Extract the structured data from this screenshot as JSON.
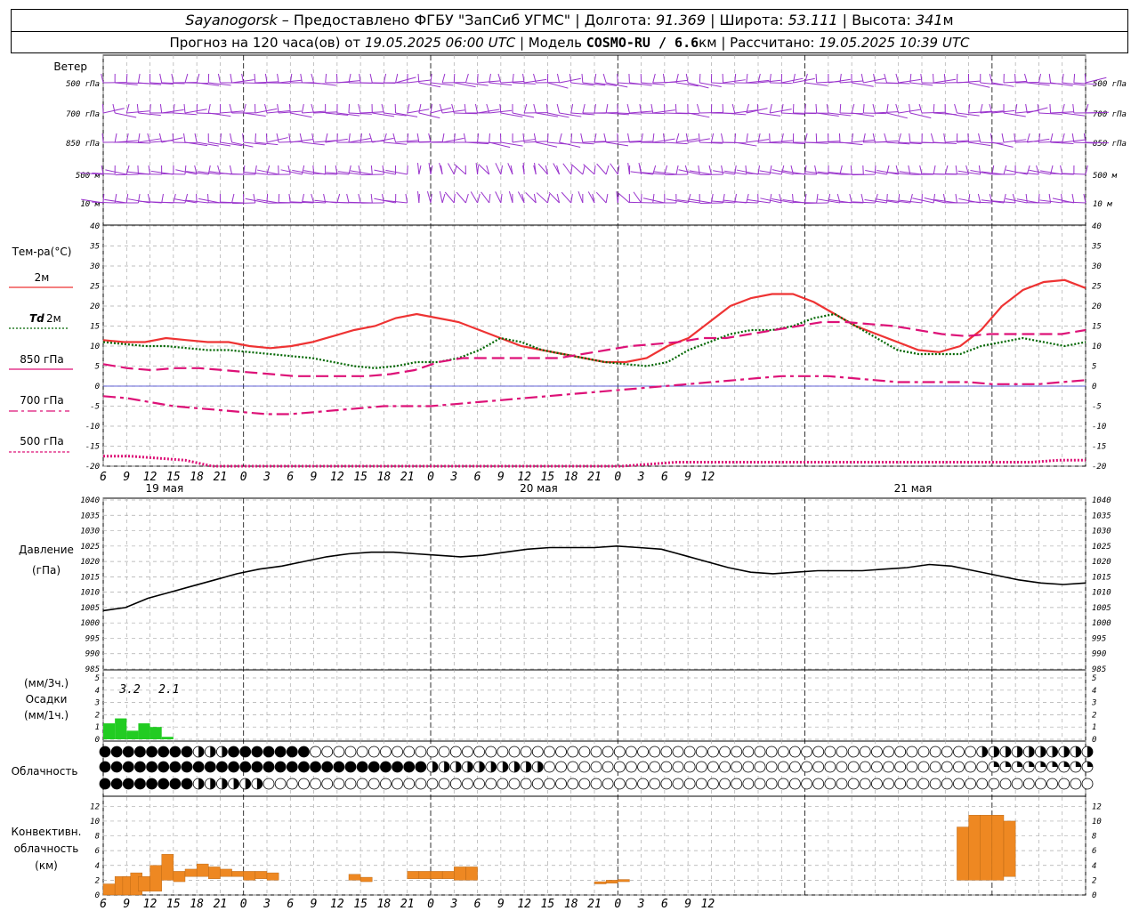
{
  "header": {
    "row1": {
      "station": "Sayanogorsk",
      "provider": " – Предоставлено ФГБУ \"ЗапСиб УГМС\" | Долгота: ",
      "lon": "91.369",
      "lat_label": " | Широта: ",
      "lat": "53.111",
      "alt_label": " | Высота: ",
      "alt": "341",
      "alt_unit": "м"
    },
    "row2": {
      "forecast": "Прогноз на 120 часа(ов) от ",
      "init": "19.05.2025 06:00 UTC",
      "model_label": " | Модель ",
      "model": "COSMO-RU / 6.6",
      "model_unit": "км",
      "calc_label": " | Рассчитано: ",
      "calc": "19.05.2025 10:39 UTC"
    }
  },
  "colors": {
    "wind": "#9933cc",
    "t2m": "#ee3333",
    "td2m": "#006600",
    "t850": "#dd1177",
    "t700": "#dd1177",
    "t500": "#dd1177",
    "pressure": "#000000",
    "precip": "#22cc22",
    "conv": "#ee8822",
    "zero": "#3333cc"
  },
  "chart_data": [
    {
      "type": "barbs",
      "title": "Ветер",
      "levels": [
        "500 гПа",
        "700 гПа",
        "850 гПа",
        "500 м",
        "10 м"
      ]
    },
    {
      "type": "line",
      "title": "Тем-ра(°C)",
      "ylim": [
        -20,
        40
      ],
      "yticks": [
        40,
        35,
        30,
        25,
        20,
        15,
        10,
        5,
        0,
        -5,
        -10,
        -15,
        -20
      ],
      "x_hours": [
        0,
        3,
        6,
        9,
        12,
        15,
        18,
        21,
        24,
        27,
        30,
        33,
        36,
        39,
        42,
        45,
        48,
        51,
        54,
        57,
        60,
        63,
        66,
        69,
        72,
        75,
        78,
        81,
        84,
        87,
        90,
        93,
        96,
        99,
        102,
        105,
        108,
        111,
        114,
        117,
        120,
        123,
        126
      ],
      "series": [
        {
          "name": "2м",
          "key": "t2m",
          "style": "solid",
          "values": [
            11.5,
            11,
            11,
            12,
            11.5,
            11,
            11,
            10,
            9.5,
            10,
            11,
            12.5,
            14,
            15,
            17,
            18,
            17,
            16,
            14,
            12,
            10,
            9,
            8,
            7,
            6,
            6,
            7,
            10,
            12,
            16,
            20,
            22,
            23,
            23,
            21,
            18,
            15,
            13,
            11,
            9,
            8.5,
            10,
            14,
            20,
            24,
            26,
            26.5,
            24.5
          ]
        },
        {
          "name": "Td 2м",
          "key": "td2m",
          "style": "dotted",
          "values": [
            11,
            10.5,
            10,
            10,
            9.5,
            9,
            9,
            8.5,
            8,
            7.5,
            7,
            6,
            5,
            4.5,
            5,
            6,
            6,
            7,
            9,
            12,
            11,
            9,
            8,
            7,
            6,
            5.5,
            5,
            6,
            9,
            11,
            13,
            14,
            14,
            15,
            17,
            18,
            15,
            12,
            9,
            8,
            8,
            8,
            10,
            11,
            12,
            11,
            10,
            11
          ]
        },
        {
          "name": "850 гПа",
          "key": "t850",
          "style": "dashed",
          "values": [
            5.5,
            4.5,
            4,
            4.5,
            4.5,
            4,
            3.5,
            3,
            2.5,
            2.5,
            2.5,
            2.5,
            3,
            4,
            6,
            7,
            7,
            7,
            7,
            7,
            8,
            9,
            10,
            10.5,
            11,
            12,
            12,
            13,
            14,
            15,
            16,
            16,
            15.5,
            15,
            14,
            13,
            12.5,
            13,
            13,
            13,
            13,
            14
          ]
        },
        {
          "name": "700 гПа",
          "key": "t700",
          "style": "dashdot",
          "values": [
            -2.5,
            -3,
            -4,
            -5,
            -5.5,
            -6,
            -6.5,
            -7,
            -7,
            -6.5,
            -6,
            -5.5,
            -5,
            -5,
            -5,
            -4.5,
            -4,
            -3.5,
            -3,
            -2.5,
            -2,
            -1.5,
            -1,
            -0.5,
            0,
            0.5,
            1,
            1.5,
            2,
            2.5,
            2.5,
            2.5,
            2,
            1.5,
            1,
            1,
            1,
            1,
            0.5,
            0.5,
            0.5,
            1,
            1.5
          ]
        },
        {
          "name": "500 гПа",
          "key": "t500",
          "style": "dotted",
          "values": [
            -17.5,
            -17.5,
            -18,
            -18.5,
            -20,
            -21,
            -22,
            -23,
            -24,
            -24,
            -23,
            -22,
            -22,
            -21,
            -21,
            -21,
            -20,
            -21,
            -20.5,
            -20,
            -19.5,
            -19,
            -19,
            -19,
            -19,
            -19,
            -19,
            -19,
            -19,
            -19,
            -19,
            -19,
            -19,
            -19,
            -19,
            -18.5,
            -18.5
          ]
        }
      ]
    },
    {
      "type": "line",
      "title": "Давление",
      "ylabel": "(гПа)",
      "ylim": [
        985,
        1040
      ],
      "yticks": [
        1040,
        1035,
        1030,
        1025,
        1020,
        1015,
        1010,
        1005,
        1000,
        995,
        990,
        985
      ],
      "series": [
        {
          "name": "Давление",
          "key": "pressure",
          "values": [
            1004,
            1005,
            1008,
            1010,
            1012,
            1014,
            1016,
            1017.5,
            1018.5,
            1020,
            1021.5,
            1022.5,
            1023,
            1023,
            1022.5,
            1022,
            1021.5,
            1022,
            1023,
            1024,
            1024.5,
            1024.5,
            1024.5,
            1025,
            1024.5,
            1024,
            1022,
            1020,
            1018,
            1016.5,
            1016,
            1016.5,
            1017,
            1017,
            1017,
            1017.5,
            1018,
            1019,
            1018.5,
            1017,
            1015.5,
            1014,
            1013,
            1012.5,
            1013
          ]
        }
      ]
    },
    {
      "type": "bar",
      "title": "Осадки",
      "ylabel_top": "(мм/3ч.)",
      "ylabel_bottom": "(мм/1ч.)",
      "ylim": [
        0,
        5
      ],
      "yticks": [
        5,
        4,
        3,
        2,
        1,
        0
      ],
      "annotations": [
        "3.2",
        "2.1"
      ],
      "values": [
        1.3,
        1.7,
        0.7,
        1.3,
        1.0,
        0.2
      ]
    },
    {
      "type": "table",
      "title": "Облачность",
      "rows": 3
    },
    {
      "type": "bar",
      "title": "Конвективн. облачность (км)",
      "ylim": [
        0,
        13
      ],
      "yticks": [
        12,
        10,
        8,
        6,
        4,
        2,
        0
      ],
      "bars": [
        {
          "h": 0,
          "base": 0,
          "top": 1.5
        },
        {
          "h": 1.5,
          "base": 0,
          "top": 2.5
        },
        {
          "h": 2.5,
          "base": 0,
          "top": 2.5
        },
        {
          "h": 3.5,
          "base": 0,
          "top": 3.0
        },
        {
          "h": 4.5,
          "base": 0.5,
          "top": 2.5
        },
        {
          "h": 6,
          "base": 0.5,
          "top": 4.0
        },
        {
          "h": 7.5,
          "base": 2,
          "top": 5.5
        },
        {
          "h": 9,
          "base": 1.8,
          "top": 3.2
        },
        {
          "h": 10.5,
          "base": 2.5,
          "top": 3.5
        },
        {
          "h": 12,
          "base": 2.5,
          "top": 4.2
        },
        {
          "h": 13.5,
          "base": 2.2,
          "top": 3.8
        },
        {
          "h": 15,
          "base": 2.5,
          "top": 3.5
        },
        {
          "h": 16.5,
          "base": 2.5,
          "top": 3.2
        },
        {
          "h": 18,
          "base": 2,
          "top": 3.2
        },
        {
          "h": 19.5,
          "base": 2.2,
          "top": 3.2
        },
        {
          "h": 21,
          "base": 2,
          "top": 3.0
        },
        {
          "h": 31.5,
          "base": 2,
          "top": 2.8
        },
        {
          "h": 33,
          "base": 1.8,
          "top": 2.4
        },
        {
          "h": 39,
          "base": 2.2,
          "top": 3.2
        },
        {
          "h": 40.5,
          "base": 2.2,
          "top": 3.2
        },
        {
          "h": 42,
          "base": 2.2,
          "top": 3.2
        },
        {
          "h": 43.5,
          "base": 2.2,
          "top": 3.2
        },
        {
          "h": 45,
          "base": 2.0,
          "top": 3.8
        },
        {
          "h": 46.5,
          "base": 2.0,
          "top": 3.8
        },
        {
          "h": 63,
          "base": 1.5,
          "top": 1.8
        },
        {
          "h": 64.5,
          "base": 1.6,
          "top": 2.0
        },
        {
          "h": 66,
          "base": 1.8,
          "top": 2.1
        },
        {
          "h": 109.5,
          "base": 2,
          "top": 9.2
        },
        {
          "h": 111,
          "base": 2,
          "top": 10.8
        },
        {
          "h": 112.5,
          "base": 2,
          "top": 10.8
        },
        {
          "h": 114,
          "base": 2,
          "top": 10.8
        },
        {
          "h": 115.5,
          "base": 2.5,
          "top": 10.0
        }
      ]
    }
  ],
  "axis": {
    "hour_labels": [
      "6",
      "9",
      "12",
      "15",
      "18",
      "21",
      "0",
      "3",
      "6",
      "9",
      "12",
      "15",
      "18",
      "21",
      "0",
      "3",
      "6",
      "9",
      "12",
      "15",
      "18",
      "21",
      "0",
      "3",
      "6",
      "9",
      "12"
    ],
    "day_labels": [
      "19 мая",
      "20 мая",
      "21 мая"
    ]
  },
  "labels": {
    "wind_title": "Ветер",
    "temp_title": "Тем-ра(°C)",
    "t2m": "2м",
    "td2m_a": "Td",
    "td2m_b": "2м",
    "t850": "850 гПа",
    "t700": "700 гПа",
    "t500": "500 гПа",
    "pressure_title": "Давление",
    "pressure_unit": "(гПа)",
    "precip_top": "(мм/3ч.)",
    "precip_title": "Осадки",
    "precip_bottom": "(мм/1ч.)",
    "clouds": "Облачность",
    "conv1": "Конвективн.",
    "conv2": "облачность",
    "conv3": "(км)"
  }
}
